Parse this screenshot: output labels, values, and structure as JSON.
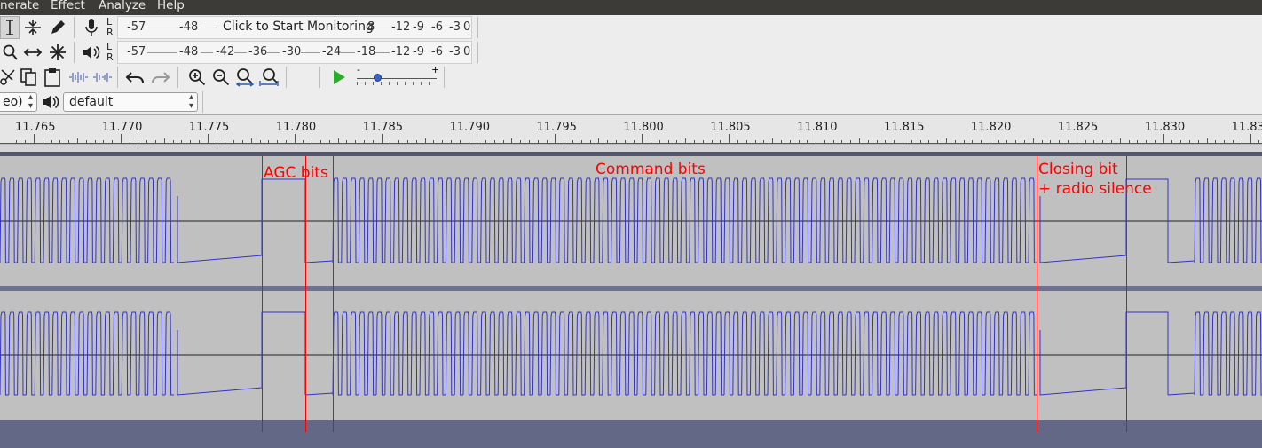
{
  "menu": [
    "nerate",
    "Effect",
    "Analyze",
    "Help"
  ],
  "toolbar": {
    "tools": [
      "selection-tool",
      "envelope-tool",
      "draw-tool",
      "zoom-tool",
      "time-shift-tool",
      "multi-tool"
    ],
    "record_meter": {
      "lr": [
        "L",
        "R"
      ],
      "scale_left": [
        "-57",
        "-48"
      ],
      "click_text": "Click to Start Monitoring",
      "scale_right": [
        "8",
        "-12",
        "-9",
        "-6",
        "-3",
        "0"
      ]
    },
    "play_meter": {
      "lr": [
        "L",
        "R"
      ],
      "scale": [
        "-57",
        "-48",
        "-42",
        "-36",
        "-30",
        "-24",
        "-18",
        "-12",
        "-9",
        "-6",
        "-3",
        "0"
      ]
    },
    "playback_speed": {
      "minus": "-",
      "plus": "+",
      "value": 0.25
    },
    "channels_value": "eo)",
    "device_value": "default"
  },
  "ruler": {
    "ticks": [
      "11.765",
      "11.770",
      "11.775",
      "11.780",
      "11.785",
      "11.790",
      "11.795",
      "11.800",
      "11.805",
      "11.810",
      "11.815",
      "11.820",
      "11.825",
      "11.830",
      "11.83"
    ]
  },
  "annotations": {
    "agc": "AGC bits",
    "command": "Command bits",
    "closing_1": "Closing bit",
    "closing_2": "+ radio silence"
  },
  "colors": {
    "waveform": "#3232c8",
    "annotation": "#ff0000",
    "track_bg": "#c0c0c0",
    "background": "#636886"
  }
}
